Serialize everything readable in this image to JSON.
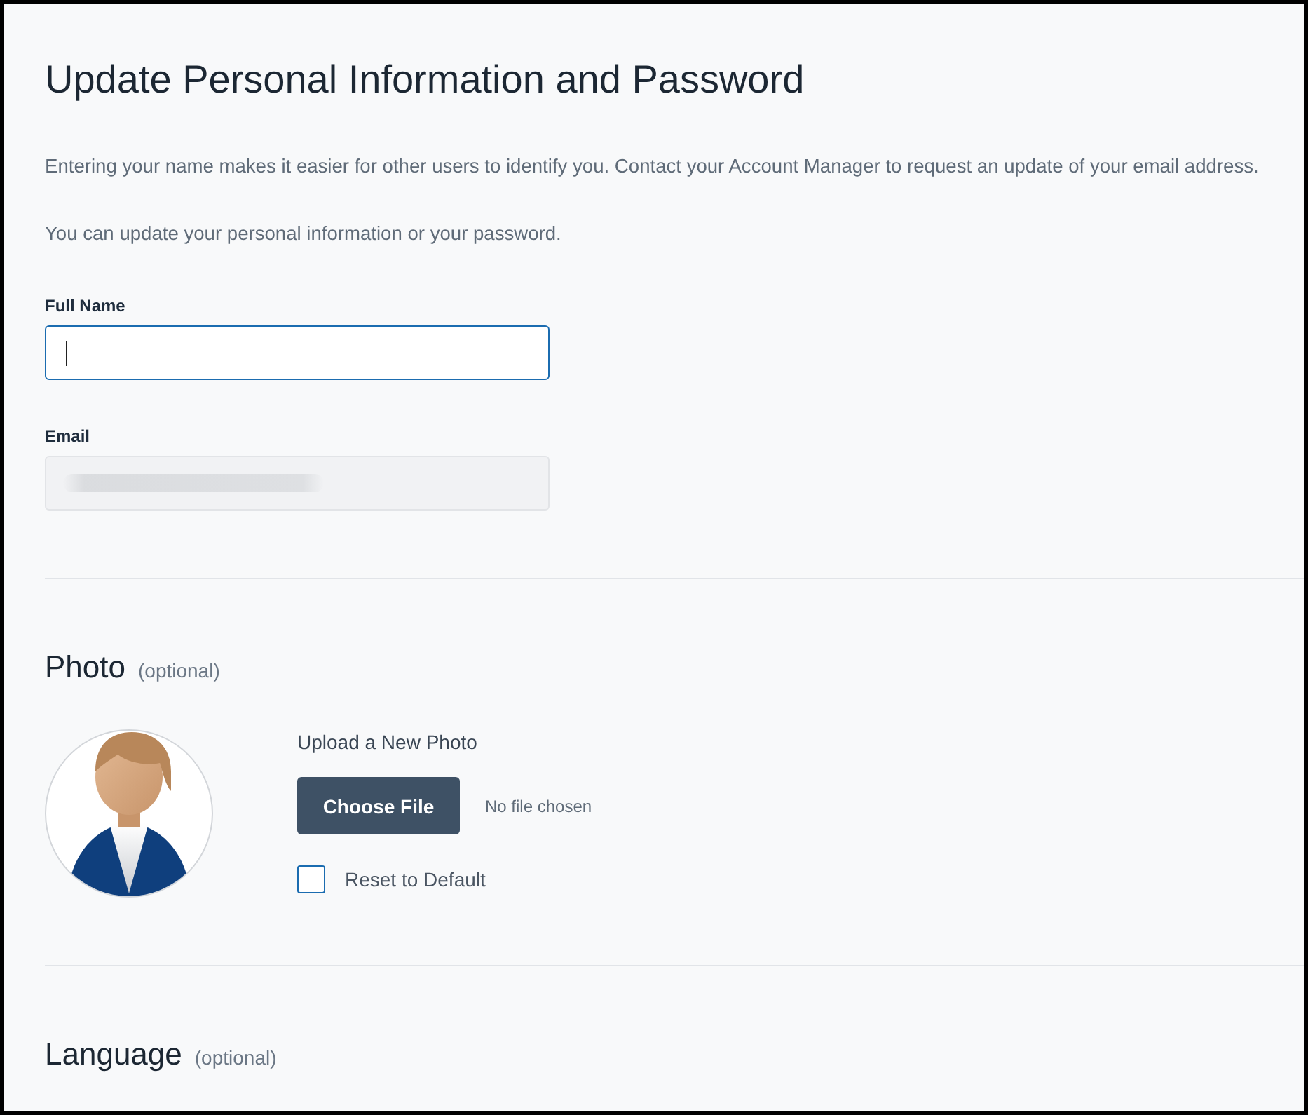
{
  "page": {
    "title": "Update Personal Information and Password",
    "intro": [
      "Entering your name makes it easier for other users to identify you. Contact your Account Manager to request an update of your email address.",
      "You can update your personal information or your password."
    ]
  },
  "fields": [
    {
      "label": "Full Name",
      "focused": true,
      "disabled": false,
      "redacted": false
    },
    {
      "label": "Email",
      "focused": false,
      "disabled": true,
      "redacted": true
    }
  ],
  "photo_section": {
    "heading": "Photo",
    "note": "(optional)",
    "upload_label": "Upload a New Photo",
    "button": "Choose File",
    "file_status": "No file chosen",
    "reset": {
      "label": "Reset to Default",
      "checked": false
    }
  },
  "language_section": {
    "heading": "Language",
    "note": "(optional)"
  }
}
